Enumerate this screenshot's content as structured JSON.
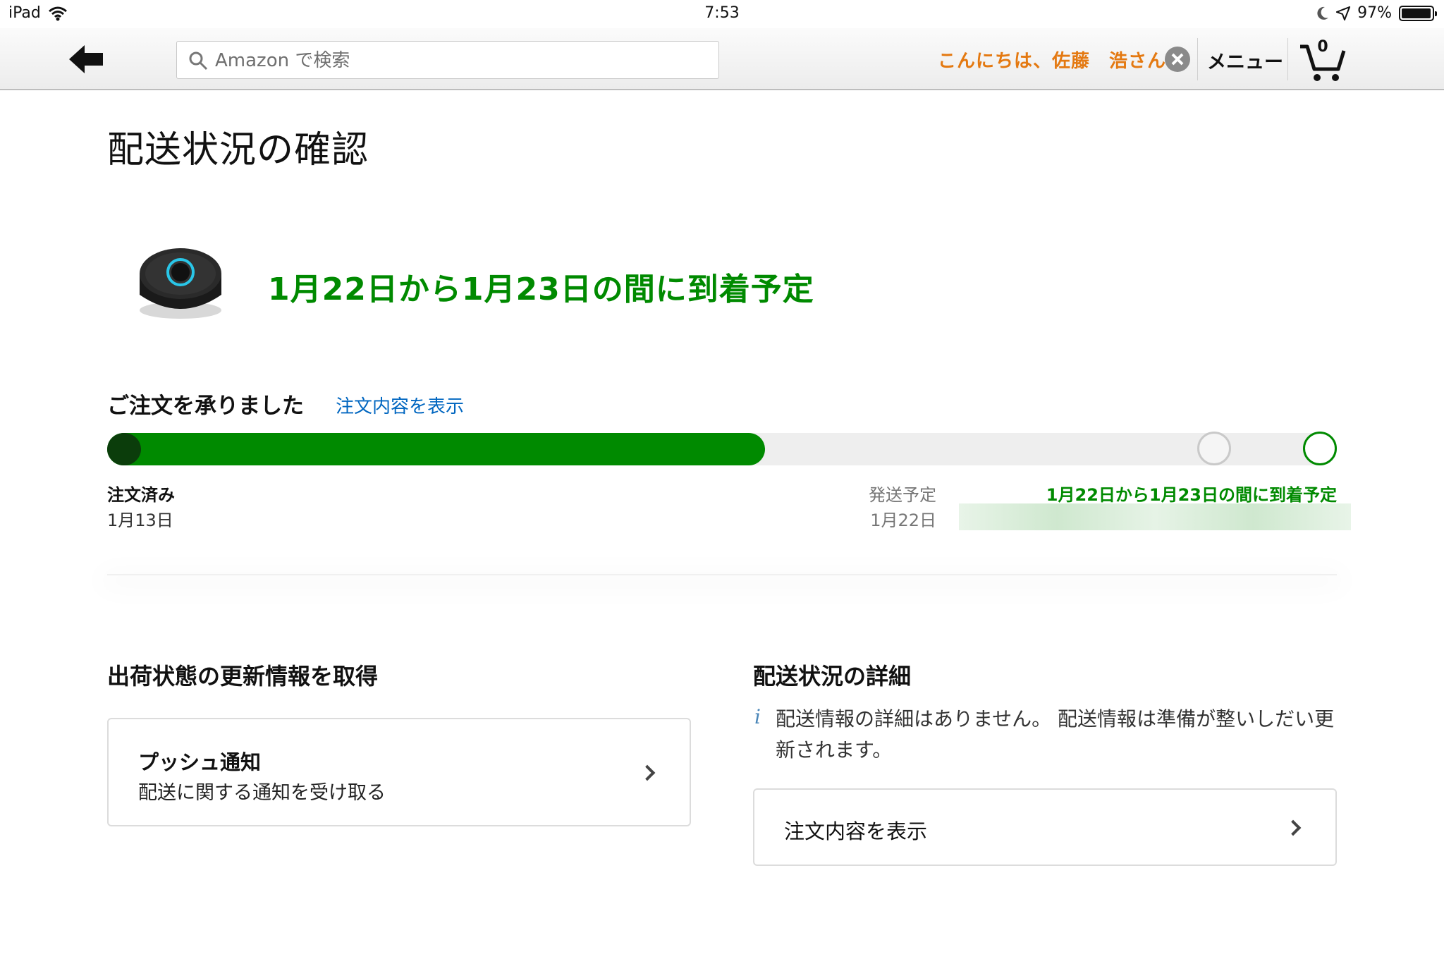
{
  "status_bar": {
    "device": "iPad",
    "time": "7:53",
    "battery": "97%",
    "battery_level": 0.97
  },
  "nav": {
    "search_placeholder": "Amazon で検索",
    "greeting": "こんにちは、佐藤　浩さん",
    "menu_label": "メニュー",
    "cart_count": "0"
  },
  "page": {
    "title": "配送状況の確認",
    "arrival_headline": "1月22日から1月23日の間に到着予定"
  },
  "tracking": {
    "status_heading": "ご注文を承りました",
    "view_order_link": "注文内容を表示",
    "progress": 0.535,
    "steps": [
      {
        "title": "注文済み",
        "date": "1月13日"
      },
      {
        "title": "発送予定",
        "date": "1月22日"
      },
      {
        "title": "1月22日から1月23日の間に到着予定"
      }
    ]
  },
  "updates": {
    "heading": "出荷状態の更新情報を取得",
    "push_title": "プッシュ通知",
    "push_subtitle": "配送に関する通知を受け取る"
  },
  "details": {
    "heading": "配送状況の詳細",
    "info_icon": "i",
    "info_text": "配送情報の詳細はありません。 配送情報は準備が整いしだい更新されます。",
    "view_order_label": "注文内容を表示"
  },
  "colors": {
    "accent_green": "#008a00",
    "greeting_orange": "#e47911",
    "link_blue": "#0066c0"
  },
  "icons": [
    "wifi-icon",
    "moon-icon",
    "location-arrow-icon",
    "battery-icon",
    "back-arrow-icon",
    "search-icon",
    "close-icon",
    "cart-icon",
    "chevron-right-icon",
    "info-icon"
  ]
}
